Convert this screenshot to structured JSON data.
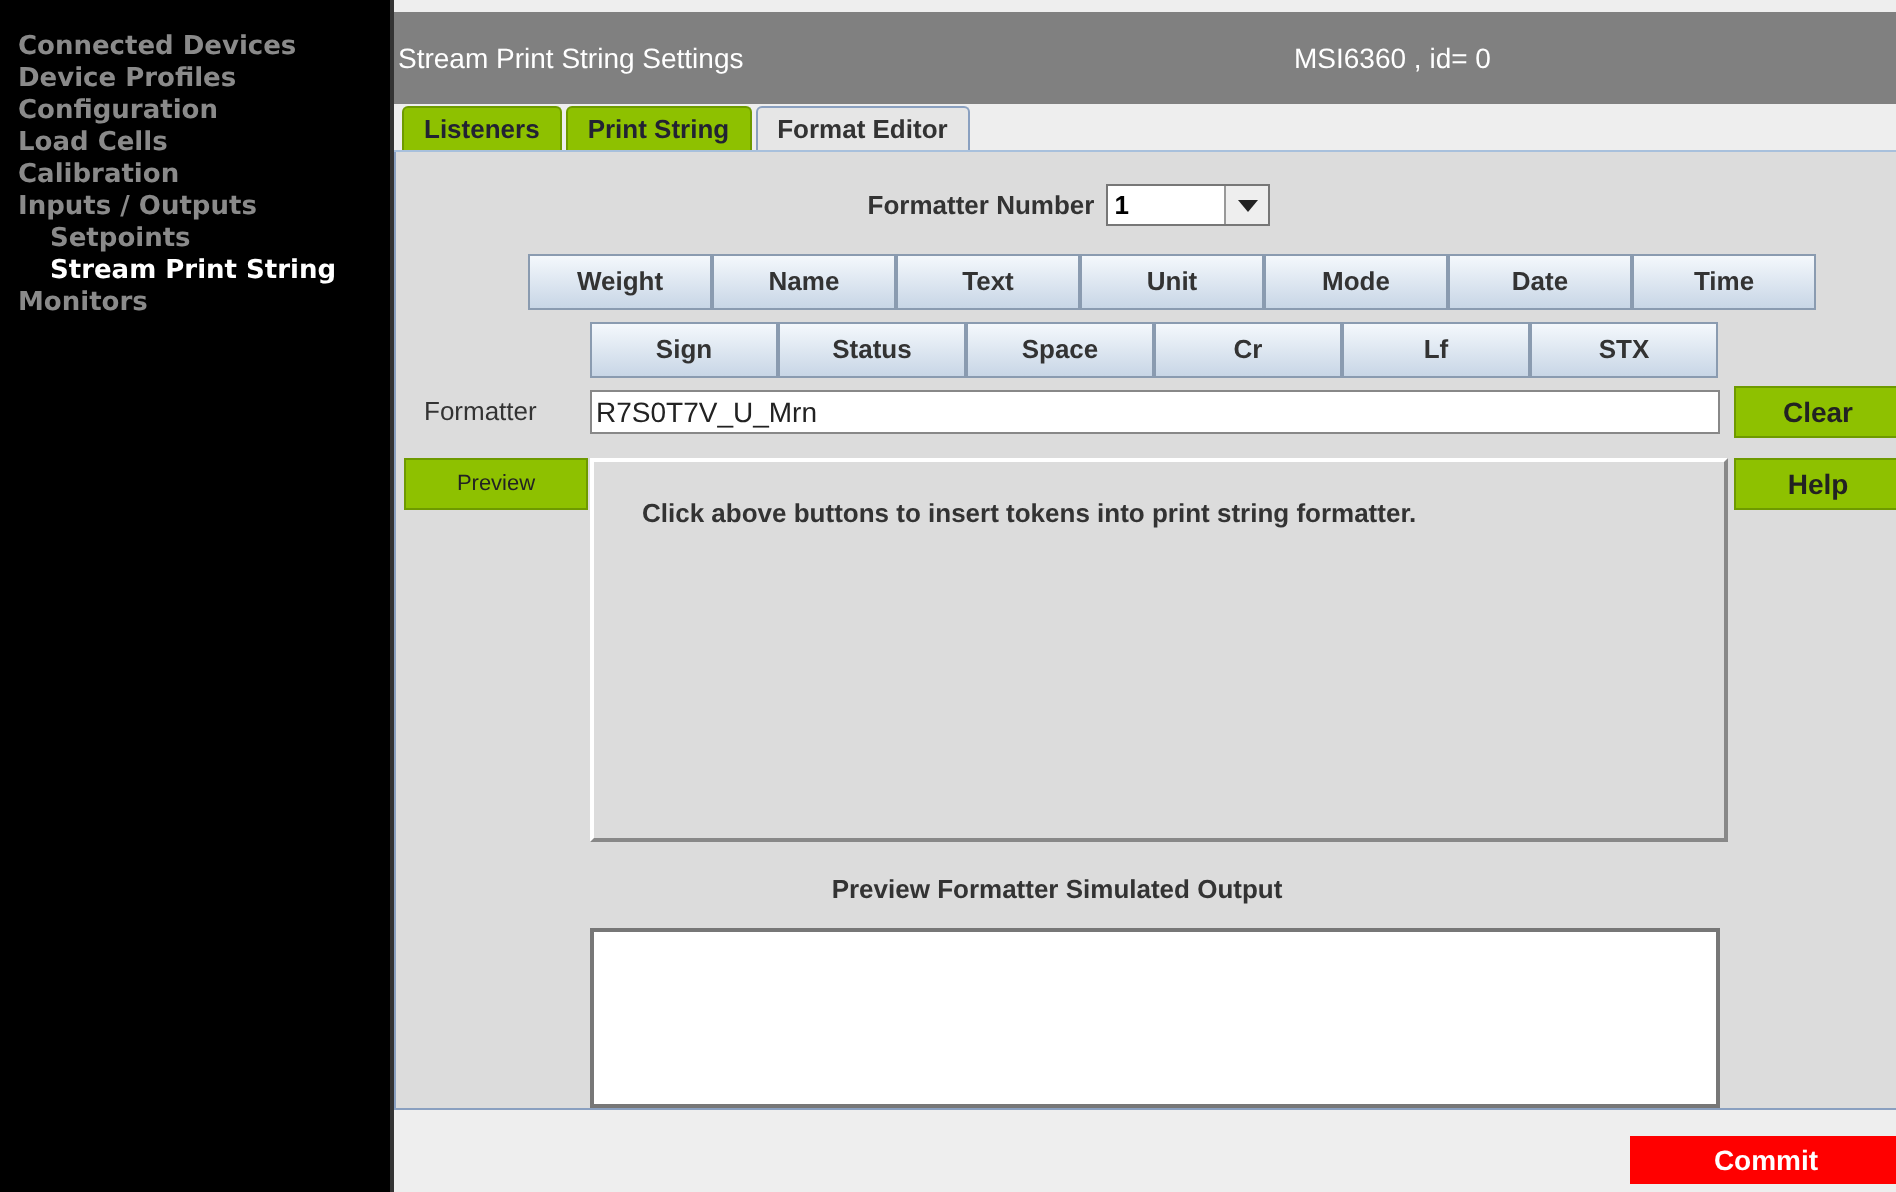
{
  "sidebar": {
    "items": [
      {
        "label": "Connected Devices",
        "selected": false
      },
      {
        "label": "Device Profiles",
        "selected": false
      },
      {
        "label": "Configuration",
        "selected": false
      },
      {
        "label": "Load Cells",
        "selected": false
      },
      {
        "label": "Calibration",
        "selected": false
      },
      {
        "label": "Inputs / Outputs",
        "selected": false,
        "children": [
          {
            "label": "Setpoints",
            "selected": false
          },
          {
            "label": "Stream Print String",
            "selected": true
          }
        ]
      },
      {
        "label": "Monitors",
        "selected": false
      }
    ]
  },
  "header": {
    "title": "Stream Print String Settings",
    "device": "MSI6360 , id= 0"
  },
  "tabs": [
    {
      "label": "Listeners",
      "selected": false
    },
    {
      "label": "Print String",
      "selected": false
    },
    {
      "label": "Format Editor",
      "selected": true
    }
  ],
  "formatter_number": {
    "label": "Formatter Number",
    "value": "1"
  },
  "token_buttons_row_1": [
    "Weight",
    "Name",
    "Text",
    "Unit",
    "Mode",
    "Date",
    "Time"
  ],
  "token_buttons_row_2": [
    "Sign",
    "Status",
    "Space",
    "Cr",
    "Lf",
    "STX"
  ],
  "formatter": {
    "label": "Formatter",
    "value": "R7S0T7V_U_Mrn"
  },
  "buttons": {
    "clear": "Clear",
    "preview": "Preview",
    "help": "Help",
    "commit": "Commit"
  },
  "message": "Click above buttons to insert tokens into print string formatter.",
  "preview_output": {
    "label": "Preview Formatter Simulated Output"
  }
}
